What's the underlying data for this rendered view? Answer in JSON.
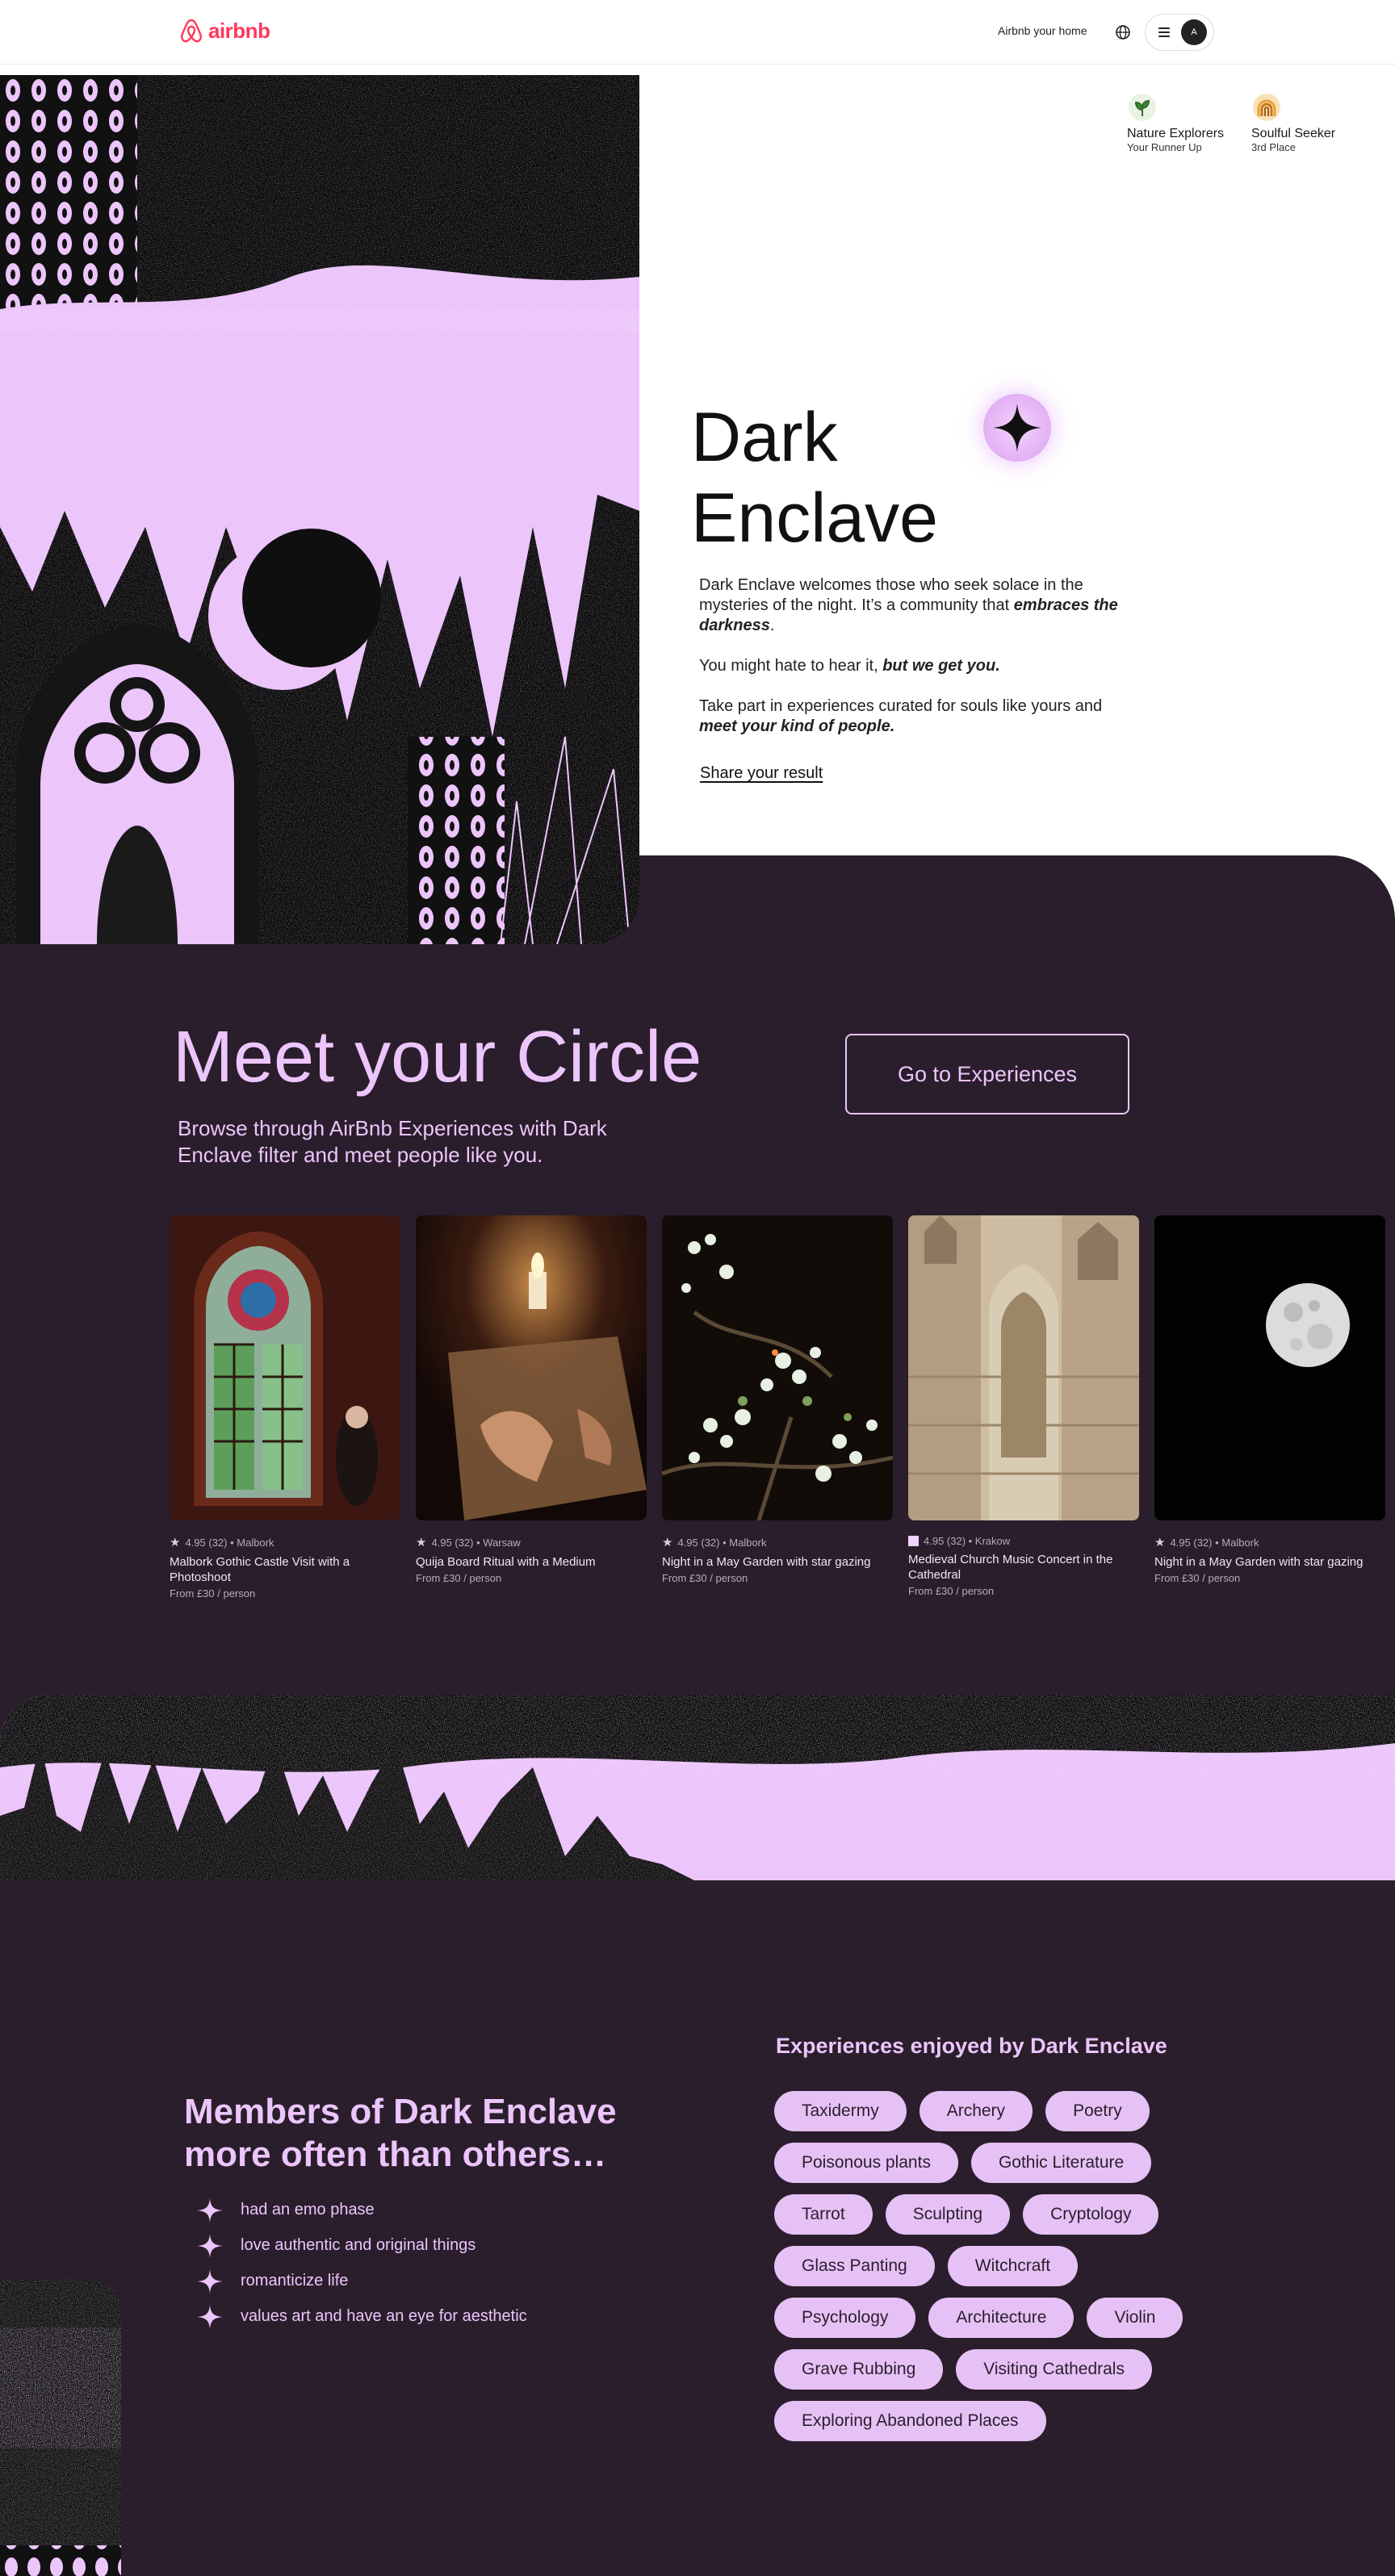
{
  "header": {
    "brand": "airbnb",
    "host_link": "Airbnb your home",
    "avatar_initial": "A"
  },
  "badges": [
    {
      "title": "Nature Explorers",
      "subtitle": "Your Runner Up",
      "icon": "plant-icon",
      "color": "#2f6b2c"
    },
    {
      "title": "Soulful Seeker",
      "subtitle": "3rd Place",
      "icon": "rainbow-icon",
      "color": "#e9a23b"
    }
  ],
  "hero": {
    "title": "Dark Enclave",
    "p1_a": "Dark Enclave welcomes those who seek solace in the mysteries of the night. It’s a community that ",
    "p1_b": "embraces the darkness",
    "p1_c": ".",
    "p2_a": "You might hate to hear it, ",
    "p2_b": "but we get you.",
    "p3_a": "Take part in experiences curated for souls like yours and ",
    "p3_b": "meet your kind of people.",
    "share": "Share your result"
  },
  "circle": {
    "title": "Meet your Circle",
    "subtitle": "Browse through AirBnb Experiences with Dark Enclave filter and meet people like you.",
    "button": "Go to Experiences"
  },
  "cards": [
    {
      "rating": "4.95 (32) • Malbork",
      "title": "Malbork Gothic Castle Visit with a Photoshoot",
      "price": "From £30 / person",
      "image": "stained-glass-window"
    },
    {
      "rating": "4.95 (32) • Warsaw",
      "title": "Quija Board Ritual with a Medium",
      "price": "From £30 / person",
      "image": "candle-ouija-board"
    },
    {
      "rating": "4.95 (32) • Malbork",
      "title": "Night in a May Garden with star gazing",
      "price": "From £30 / person",
      "image": "blossom-night"
    },
    {
      "rating": "4.95 (32) • Krakow",
      "title": "Medieval Church Music Concert in the Cathedral",
      "price": "From £30 / person",
      "image": "cathedral-facade"
    },
    {
      "rating": "4.95 (32) • Malbork",
      "title": "Night in a May Garden with star gazing",
      "price": "From £30 / person",
      "image": "full-moon"
    }
  ],
  "members": {
    "title": "Members of Dark Enclave more often than others…",
    "traits": [
      "had an emo phase",
      "love authentic and original things",
      "romanticize life",
      "values art and have an eye for aesthetic"
    ]
  },
  "experiences": {
    "title": "Experiences enjoyed by Dark Enclave",
    "tags": [
      "Taxidermy",
      "Archery",
      "Poetry",
      "Poisonous plants",
      "Gothic Literature",
      "Tarrot",
      "Sculpting",
      "Cryptology",
      "Glass Panting",
      "Witchcraft",
      "Psychology",
      "Architecture",
      "Violin",
      "Grave Rubbing",
      "Visiting Cathedrals",
      "Exploring Abandoned Places"
    ]
  },
  "colors": {
    "accent": "#ff385c",
    "lavender": "#ecc5fb",
    "dark": "#2a1e2c"
  }
}
